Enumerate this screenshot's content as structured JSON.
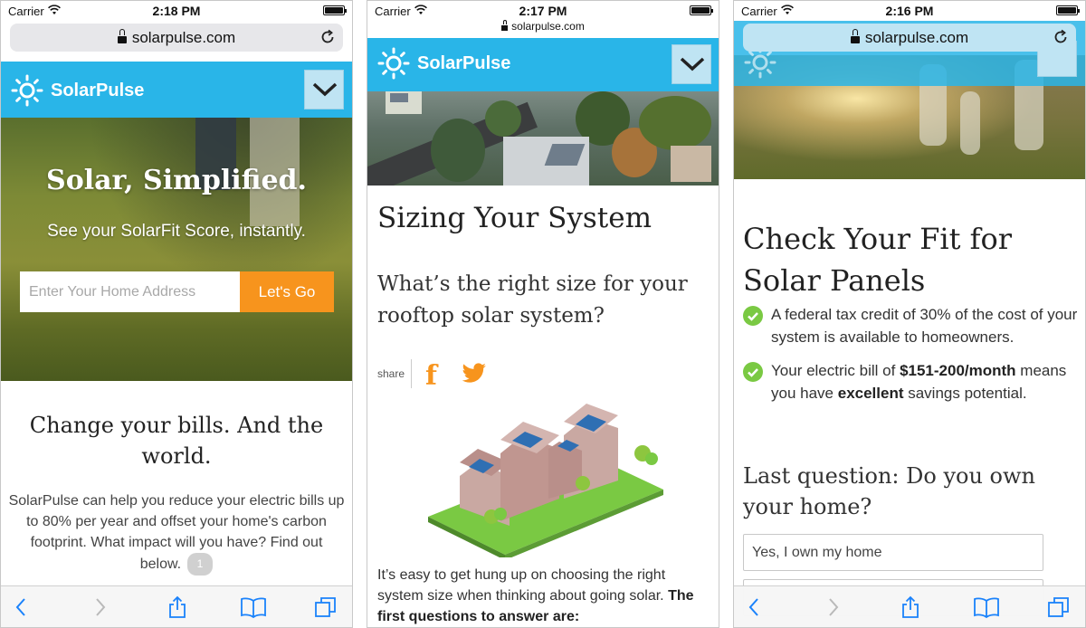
{
  "colors": {
    "brand": "#29b5e8",
    "accent": "#f7941d",
    "check": "#7ac943"
  },
  "screens": [
    {
      "status": {
        "carrier": "Carrier",
        "time": "2:18 PM"
      },
      "url": "solarpulse.com",
      "header": {
        "brand": "SolarPulse"
      },
      "hero": {
        "title": "Solar, Simplified.",
        "subtitle": "See your SolarFit Score, instantly.",
        "address_placeholder": "Enter Your Home Address",
        "button": "Let's Go"
      },
      "section": {
        "heading": "Change your bills. And the world.",
        "body": "SolarPulse can help you reduce your electric bills up to 80% per year and offset your home's carbon footprint. What impact will you have? Find out below.",
        "badge": "1"
      }
    },
    {
      "status": {
        "carrier": "Carrier",
        "time": "2:17 PM"
      },
      "url": "solarpulse.com",
      "header": {
        "brand": "SolarPulse"
      },
      "article": {
        "title": "Sizing Your System",
        "subtitle": "What’s the right size for your rooftop solar system?",
        "share_label": "share",
        "facebook": "f",
        "body": "It’s easy to get hung up on choosing the right system size when thinking about going solar.",
        "body_bold": "The first questions to answer are:"
      }
    },
    {
      "status": {
        "carrier": "Carrier",
        "time": "2:16 PM"
      },
      "url": "solarpulse.com",
      "header": {
        "brand": "SolarPulse"
      },
      "fit": {
        "title_line1": "Check Your Fit for",
        "title_line2": "Solar Panels",
        "check1": "A federal tax credit of 30% of the cost of your system is available to homeowners.",
        "check2_pre": "Your electric bill of ",
        "check2_bold1": "$151-200/month",
        "check2_mid": " means you have ",
        "check2_bold2": "excellent",
        "check2_post": " savings potential.",
        "question": "Last question: Do you own your home?",
        "option1": "Yes, I own my home"
      }
    }
  ]
}
